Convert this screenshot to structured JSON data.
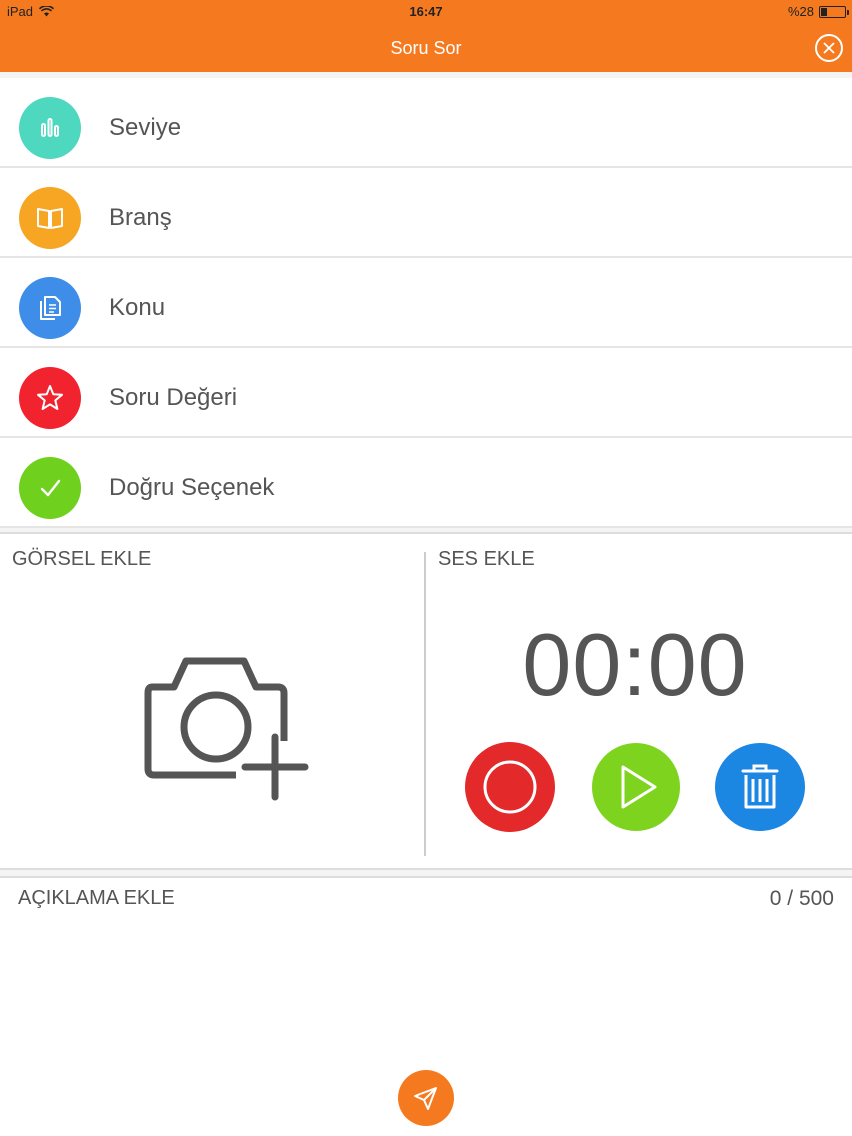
{
  "status_bar": {
    "carrier": "iPad",
    "time": "16:47",
    "battery": "%28",
    "battery_level": 0.28
  },
  "nav": {
    "title": "Soru Sor",
    "close_icon": "close-icon"
  },
  "colors": {
    "primary": "#f57a1f",
    "teal": "#4fd8c0",
    "yellow": "#f6a623",
    "blue": "#3e8ee9",
    "red": "#f1232f",
    "green": "#6fd11d",
    "record": "#e32929",
    "play": "#7dd31d",
    "delete": "#1c86e3"
  },
  "menu": {
    "items": [
      {
        "label": "Seviye",
        "icon": "bar-chart-icon"
      },
      {
        "label": "Branş",
        "icon": "book-icon"
      },
      {
        "label": "Konu",
        "icon": "document-icon"
      },
      {
        "label": "Soru Değeri",
        "icon": "star-icon"
      },
      {
        "label": "Doğru Seçenek",
        "icon": "checkmark-icon"
      }
    ]
  },
  "image_section": {
    "title": "GÖRSEL EKLE",
    "icon": "camera-add-icon"
  },
  "audio_section": {
    "title": "SES EKLE",
    "timer": "00:00",
    "record_icon": "record-icon",
    "play_icon": "play-icon",
    "delete_icon": "trash-icon"
  },
  "description": {
    "title": "AÇIKLAMA EKLE",
    "counter": "0 / 500",
    "text": ""
  },
  "send": {
    "icon": "send-icon"
  }
}
